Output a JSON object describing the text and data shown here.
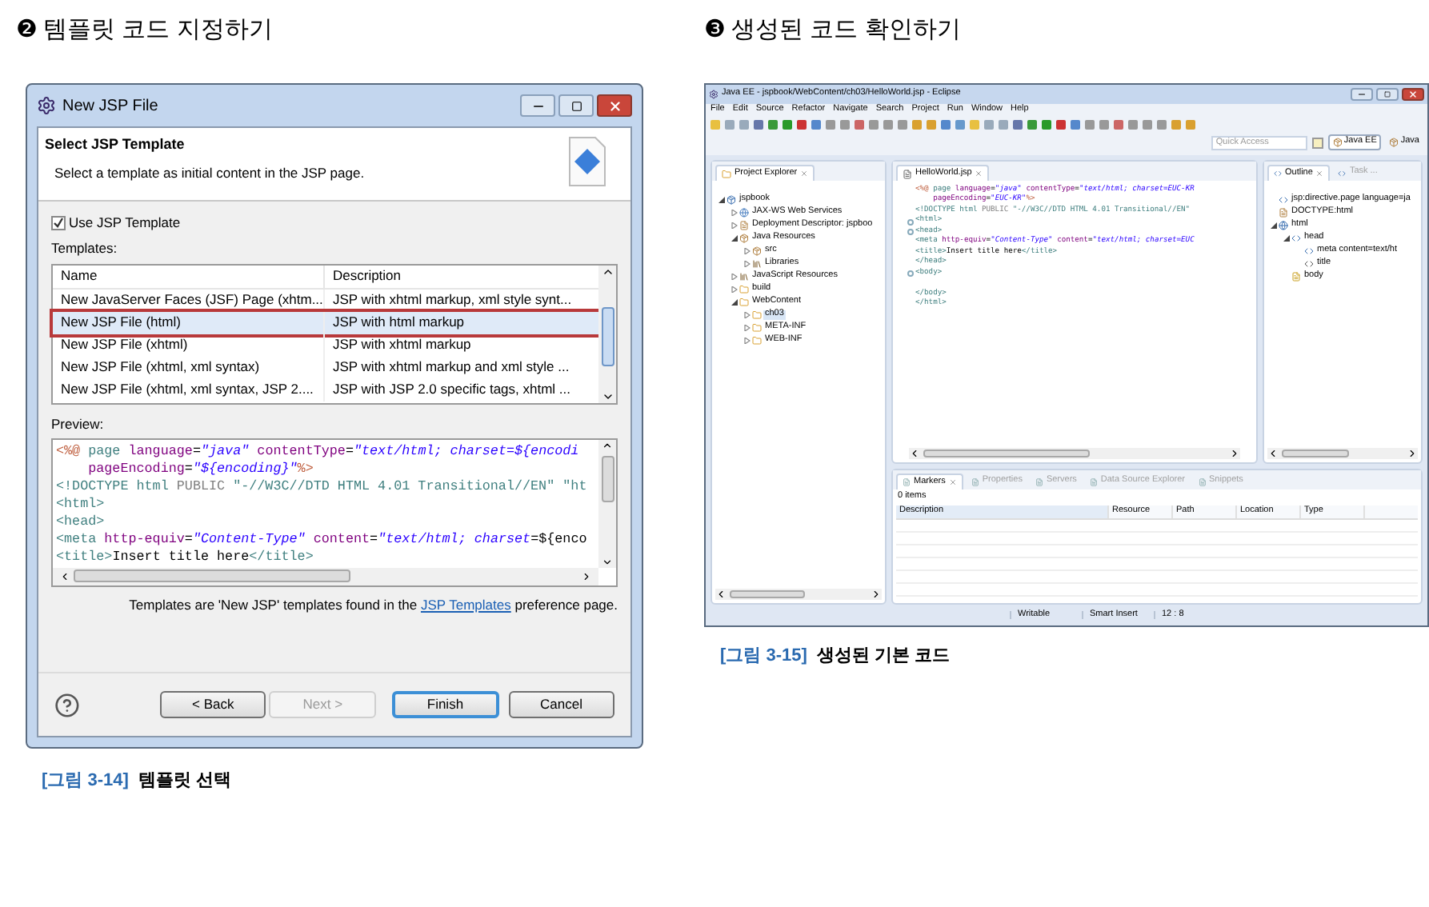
{
  "left": {
    "step_number": "❷",
    "heading": "템플릿 코드 지정하기",
    "dialog": {
      "title": "New JSP File",
      "header_title": "Select JSP Template",
      "header_subtitle": "Select a template as initial content in the JSP page.",
      "use_template": {
        "label": "Use JSP Template",
        "checked": true
      },
      "templates_label": "Templates:",
      "table": {
        "columns": [
          "Name",
          "Description"
        ],
        "rows": [
          {
            "name": "New JavaServer Faces (JSF) Page (xhtm...",
            "description": "JSP with xhtml markup, xml style synt...",
            "selected": false
          },
          {
            "name": "New JSP File (html)",
            "description": "JSP with html markup",
            "selected": true
          },
          {
            "name": "New JSP File (xhtml)",
            "description": "JSP with xhtml markup",
            "selected": false
          },
          {
            "name": "New JSP File (xhtml, xml syntax)",
            "description": "JSP with xhtml markup and xml style ...",
            "selected": false
          },
          {
            "name": "New JSP File (xhtml, xml syntax, JSP 2....",
            "description": "JSP with JSP 2.0 specific tags, xhtml ...",
            "selected": false
          }
        ]
      },
      "preview_label": "Preview:",
      "preview_lines": [
        [
          {
            "text": "<%@",
            "kind": "delim"
          },
          {
            "text": " page ",
            "kind": "tag"
          },
          {
            "text": "language",
            "kind": "attr"
          },
          {
            "text": "=",
            "kind": "text"
          },
          {
            "text": "\"java\"",
            "kind": "value"
          },
          {
            "text": " contentType",
            "kind": "attr"
          },
          {
            "text": "=",
            "kind": "text"
          },
          {
            "text": "\"text/html; charset=${encodi",
            "kind": "value"
          }
        ],
        [
          {
            "text": "    pageEncoding",
            "kind": "attr"
          },
          {
            "text": "=",
            "kind": "text"
          },
          {
            "text": "\"${encoding}\"",
            "kind": "value"
          },
          {
            "text": "%>",
            "kind": "delim"
          }
        ],
        [
          {
            "text": "<!DOCTYPE html ",
            "kind": "tag"
          },
          {
            "text": "PUBLIC ",
            "kind": "plain"
          },
          {
            "text": "\"-//W3C//DTD HTML 4.01 Transitional//EN\" \"ht",
            "kind": "tag"
          }
        ],
        [
          {
            "text": "<html>",
            "kind": "tag"
          }
        ],
        [
          {
            "text": "<head>",
            "kind": "tag"
          }
        ],
        [
          {
            "text": "<meta ",
            "kind": "tag"
          },
          {
            "text": "http-equiv",
            "kind": "attr"
          },
          {
            "text": "=",
            "kind": "text"
          },
          {
            "text": "\"Content-Type\"",
            "kind": "value"
          },
          {
            "text": " content",
            "kind": "attr"
          },
          {
            "text": "=",
            "kind": "text"
          },
          {
            "text": "\"text/html; charset",
            "kind": "value"
          },
          {
            "text": "=${enco",
            "kind": "text"
          }
        ],
        [
          {
            "text": "<title>",
            "kind": "tag"
          },
          {
            "text": "Insert title here",
            "kind": "text"
          },
          {
            "text": "</title>",
            "kind": "tag"
          }
        ]
      ],
      "note": {
        "before": "Templates are 'New JSP' templates found in the ",
        "link": "JSP Templates",
        "after": " preference page."
      },
      "buttons": [
        {
          "label": "< Back",
          "disabled": false,
          "default": false
        },
        {
          "label": "Next >",
          "disabled": true,
          "default": false
        },
        {
          "label": "Finish",
          "disabled": false,
          "default": true
        },
        {
          "label": "Cancel",
          "disabled": false,
          "default": false
        }
      ]
    },
    "caption": {
      "number": "[그림 3-14]",
      "text": "템플릿 선택"
    }
  },
  "right": {
    "step_number": "❸",
    "heading": "생성된 코드 확인하기",
    "eclipse": {
      "title": "Java EE - jspbook/WebContent/ch03/HelloWorld.jsp - Eclipse",
      "menu": [
        "File",
        "Edit",
        "Source",
        "Refactor",
        "Navigate",
        "Search",
        "Project",
        "Run",
        "Window",
        "Help"
      ],
      "quick_access": {
        "placeholder": "Quick Access"
      },
      "perspectives": [
        {
          "label": "Java EE",
          "selected": true
        },
        {
          "label": "Java",
          "selected": false
        }
      ],
      "explorer": {
        "title": "Project Explorer",
        "tree": [
          {
            "label": "jspbook",
            "kind": "project",
            "expanded": true,
            "selected": false,
            "children": [
              {
                "label": "JAX-WS Web Services",
                "kind": "services",
                "expanded": false,
                "selected": false
              },
              {
                "label": "Deployment Descriptor: jspboo",
                "kind": "descriptor",
                "expanded": false,
                "selected": false
              },
              {
                "label": "Java Resources",
                "kind": "package",
                "expanded": true,
                "selected": false,
                "children": [
                  {
                    "label": "src",
                    "kind": "source",
                    "expanded": false,
                    "selected": false
                  },
                  {
                    "label": "Libraries",
                    "kind": "library",
                    "expanded": false,
                    "selected": false
                  }
                ]
              },
              {
                "label": "JavaScript Resources",
                "kind": "library",
                "expanded": false,
                "selected": false
              },
              {
                "label": "build",
                "kind": "folder",
                "expanded": false,
                "selected": false
              },
              {
                "label": "WebContent",
                "kind": "folder",
                "expanded": true,
                "selected": false,
                "children": [
                  {
                    "label": "ch03",
                    "kind": "folder",
                    "expanded": false,
                    "selected": true
                  },
                  {
                    "label": "META-INF",
                    "kind": "folder",
                    "expanded": false,
                    "selected": false
                  },
                  {
                    "label": "WEB-INF",
                    "kind": "folder",
                    "expanded": false,
                    "selected": false
                  }
                ]
              }
            ]
          }
        ]
      },
      "editor": {
        "tab": "HelloWorld.jsp",
        "lines": [
          {
            "kind": "code",
            "tokens": [
              {
                "text": "<%@",
                "kind": "delim"
              },
              {
                "text": " page ",
                "kind": "tag"
              },
              {
                "text": "language",
                "kind": "attr"
              },
              {
                "text": "=",
                "kind": "text"
              },
              {
                "text": "\"java\"",
                "kind": "value"
              },
              {
                "text": " contentType",
                "kind": "attr"
              },
              {
                "text": "=",
                "kind": "text"
              },
              {
                "text": "\"text/html; charset=EUC-KR",
                "kind": "value"
              }
            ]
          },
          {
            "kind": "code",
            "tokens": [
              {
                "text": "    pageEncoding",
                "kind": "attr"
              },
              {
                "text": "=",
                "kind": "text"
              },
              {
                "text": "\"EUC-KR\"",
                "kind": "value"
              },
              {
                "text": "%>",
                "kind": "delim"
              }
            ]
          },
          {
            "kind": "code",
            "tokens": [
              {
                "text": "<!DOCTYPE html ",
                "kind": "tag"
              },
              {
                "text": "PUBLIC ",
                "kind": "plain"
              },
              {
                "text": "\"-//W3C//DTD HTML 4.01 Transitional//EN\"",
                "kind": "tag"
              }
            ]
          },
          {
            "kind": "code",
            "fold": true,
            "tokens": [
              {
                "text": "<html>",
                "kind": "tag"
              }
            ]
          },
          {
            "kind": "code",
            "fold": true,
            "tokens": [
              {
                "text": "<head>",
                "kind": "tag"
              }
            ]
          },
          {
            "kind": "code",
            "tokens": [
              {
                "text": "<meta ",
                "kind": "tag"
              },
              {
                "text": "http-equiv",
                "kind": "attr"
              },
              {
                "text": "=",
                "kind": "text"
              },
              {
                "text": "\"Content-Type\"",
                "kind": "value"
              },
              {
                "text": " content",
                "kind": "attr"
              },
              {
                "text": "=",
                "kind": "text"
              },
              {
                "text": "\"text/html; charset=EUC",
                "kind": "value"
              }
            ]
          },
          {
            "kind": "code",
            "tokens": [
              {
                "text": "<title>",
                "kind": "tag"
              },
              {
                "text": "Insert title here",
                "kind": "text"
              },
              {
                "text": "</title>",
                "kind": "tag"
              }
            ]
          },
          {
            "kind": "code",
            "tokens": [
              {
                "text": "</head>",
                "kind": "tag"
              }
            ]
          },
          {
            "kind": "code",
            "fold": true,
            "tokens": [
              {
                "text": "<body>",
                "kind": "tag"
              }
            ]
          },
          {
            "kind": "blank"
          },
          {
            "kind": "code",
            "tokens": [
              {
                "text": "</body>",
                "kind": "tag"
              }
            ]
          },
          {
            "kind": "code",
            "tokens": [
              {
                "text": "</html>",
                "kind": "tag"
              }
            ]
          }
        ]
      },
      "outline": {
        "tabs": [
          {
            "label": "Outline",
            "selected": true
          },
          {
            "label": "Task ...",
            "selected": false
          }
        ],
        "tree": [
          {
            "label": "jsp:directive.page language=ja",
            "kind": "tag"
          },
          {
            "label": "DOCTYPE:html",
            "kind": "doctype"
          },
          {
            "label": "html",
            "kind": "element",
            "expanded": true,
            "children": [
              {
                "label": "head",
                "kind": "tag",
                "expanded": true,
                "children": [
                  {
                    "label": "meta content=text/ht",
                    "kind": "tag"
                  },
                  {
                    "label": "title",
                    "kind": "title"
                  }
                ]
              },
              {
                "label": "body",
                "kind": "body"
              }
            ]
          }
        ]
      },
      "bottom": {
        "tabs": [
          {
            "label": "Markers",
            "selected": true
          },
          {
            "label": "Properties",
            "selected": false
          },
          {
            "label": "Servers",
            "selected": false
          },
          {
            "label": "Data Source Explorer",
            "selected": false
          },
          {
            "label": "Snippets",
            "selected": false
          }
        ],
        "count": "0 items",
        "columns": [
          "Description",
          "Resource",
          "Path",
          "Location",
          "Type"
        ]
      },
      "status": [
        "Writable",
        "Smart Insert",
        "12 : 8"
      ]
    },
    "caption": {
      "number": "[그림 3-15]",
      "text": "생성된 기본 코드"
    }
  }
}
